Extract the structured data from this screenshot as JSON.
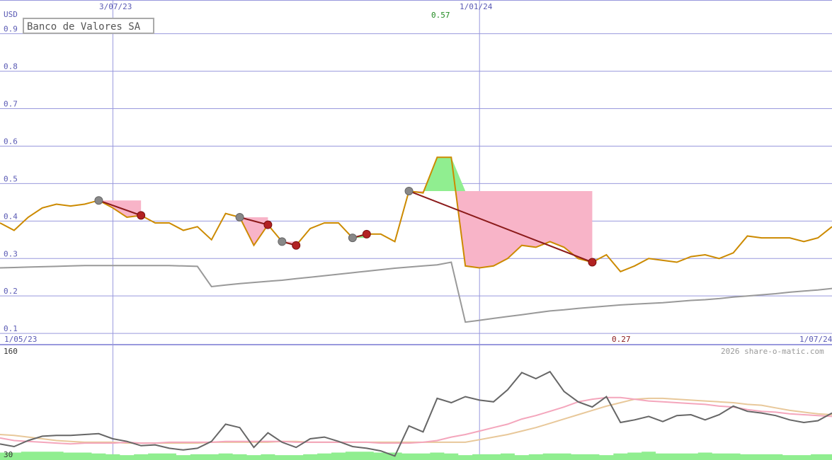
{
  "chart_data": [
    {
      "type": "line",
      "title": "Banco de Valores SA",
      "ylabel": "USD",
      "ylim": [
        0.07,
        0.99
      ],
      "y_ticks": [
        "0.9",
        "0.8",
        "0.7",
        "0.6",
        "0.5",
        "0.4",
        "0.3",
        "0.2",
        "0.1"
      ],
      "x_top_labels": [
        "3/07/23",
        "1/01/24"
      ],
      "x_bottom_labels": [
        "1/05/23",
        "1/07/24"
      ],
      "annotations": {
        "high": "0.57",
        "low": "0.27"
      },
      "colors": {
        "price": "#cc8a00",
        "moving_average": "#999999",
        "trend": "#8b1a1a",
        "grid": "#9999dd",
        "loss_fill": "#f8b4c8",
        "gain_fill": "#90ee90"
      },
      "x": [
        0,
        1,
        2,
        3,
        4,
        5,
        6,
        7,
        8,
        9,
        10,
        11,
        12,
        13,
        14,
        15,
        16,
        17,
        18,
        19,
        20,
        21,
        22,
        23,
        24,
        25,
        26,
        27,
        28,
        29,
        30,
        31,
        32,
        33,
        34,
        35,
        36,
        37,
        38,
        39,
        40,
        41,
        42,
        43,
        44,
        45,
        46,
        47,
        48,
        49,
        50,
        51,
        52,
        53,
        54,
        55,
        56,
        57,
        58,
        59
      ],
      "series": [
        {
          "role": "price",
          "values": [
            0.395,
            0.375,
            0.41,
            0.435,
            0.445,
            0.44,
            0.445,
            0.455,
            0.435,
            0.41,
            0.415,
            0.395,
            0.395,
            0.375,
            0.385,
            0.35,
            0.42,
            0.41,
            0.335,
            0.39,
            0.345,
            0.335,
            0.38,
            0.395,
            0.395,
            0.355,
            0.365,
            0.365,
            0.345,
            0.48,
            0.475,
            0.57,
            0.57,
            0.28,
            0.275,
            0.28,
            0.3,
            0.335,
            0.33,
            0.345,
            0.33,
            0.3,
            0.29,
            0.31,
            0.265,
            0.28,
            0.3,
            0.295,
            0.29,
            0.305,
            0.31,
            0.3,
            0.315,
            0.36,
            0.355,
            0.355,
            0.355,
            0.345,
            0.355,
            0.385
          ]
        },
        {
          "role": "moving_average",
          "values": [
            0.275,
            0.276,
            0.277,
            0.278,
            0.279,
            0.28,
            0.281,
            0.281,
            0.281,
            0.281,
            0.281,
            0.281,
            0.281,
            0.28,
            0.279,
            0.225,
            0.229,
            0.233,
            0.236,
            0.239,
            0.242,
            0.246,
            0.25,
            0.254,
            0.258,
            0.262,
            0.266,
            0.27,
            0.274,
            0.277,
            0.28,
            0.283,
            0.29,
            0.13,
            0.135,
            0.14,
            0.145,
            0.15,
            0.155,
            0.16,
            0.163,
            0.167,
            0.17,
            0.173,
            0.176,
            0.178,
            0.18,
            0.182,
            0.185,
            0.188,
            0.19,
            0.193,
            0.197,
            0.2,
            0.203,
            0.206,
            0.21,
            0.213,
            0.216,
            0.22
          ]
        }
      ],
      "trend_segments": [
        [
          7,
          10
        ],
        [
          17,
          19
        ],
        [
          20,
          21
        ],
        [
          25,
          26
        ],
        [
          29,
          42
        ]
      ]
    },
    {
      "type": "line",
      "ylim": [
        30,
        160
      ],
      "y_ticks": [
        "160",
        "30"
      ],
      "watermark": "2026 share-o-matic.com",
      "x": [
        0,
        1,
        2,
        3,
        4,
        5,
        6,
        7,
        8,
        9,
        10,
        11,
        12,
        13,
        14,
        15,
        16,
        17,
        18,
        19,
        20,
        21,
        22,
        23,
        24,
        25,
        26,
        27,
        28,
        29,
        30,
        31,
        32,
        33,
        34,
        35,
        36,
        37,
        38,
        39,
        40,
        41,
        42,
        43,
        44,
        45,
        46,
        47,
        48,
        49,
        50,
        51,
        52,
        53,
        54,
        55,
        56,
        57,
        58,
        59
      ],
      "series": [
        {
          "role": "momentum",
          "values": [
            47,
            44,
            51,
            56,
            57,
            57,
            58,
            59,
            53,
            50,
            45,
            46,
            42,
            40,
            42,
            50,
            70,
            66,
            43,
            60,
            49,
            43,
            53,
            55,
            50,
            44,
            42,
            39,
            33,
            68,
            61,
            100,
            95,
            102,
            98,
            96,
            110,
            130,
            123,
            131,
            108,
            96,
            90,
            102,
            72,
            75,
            79,
            73,
            80,
            81,
            75,
            81,
            91,
            85,
            83,
            80,
            75,
            72,
            74,
            83
          ]
        },
        {
          "role": "moving_average_1",
          "values": [
            54,
            51,
            50,
            49,
            48,
            47,
            48,
            48,
            48,
            49,
            48,
            48,
            49,
            49,
            49,
            49,
            50,
            50,
            50,
            50,
            50,
            49,
            49,
            49,
            49,
            49,
            49,
            48,
            48,
            48,
            49,
            51,
            55,
            58,
            62,
            66,
            70,
            76,
            80,
            85,
            90,
            96,
            99,
            101,
            101,
            99,
            97,
            96,
            95,
            94,
            93,
            91,
            90,
            87,
            85,
            84,
            82,
            81,
            80,
            79
          ]
        },
        {
          "role": "moving_average_2",
          "values": [
            58,
            57,
            55,
            53,
            51,
            50,
            49,
            49,
            49,
            48,
            48,
            48,
            48,
            48,
            48,
            49,
            49,
            49,
            49,
            49,
            50,
            50,
            49,
            49,
            49,
            49,
            49,
            49,
            49,
            49,
            49,
            49,
            49,
            49,
            52,
            55,
            58,
            62,
            66,
            71,
            76,
            81,
            86,
            91,
            95,
            99,
            100,
            100,
            99,
            98,
            97,
            96,
            95,
            93,
            92,
            89,
            86,
            84,
            82,
            81
          ]
        },
        {
          "role": "volume",
          "values": [
            37,
            37,
            38,
            38,
            38,
            37,
            37,
            36,
            35,
            34,
            35,
            36,
            36,
            34,
            35,
            35,
            36,
            35,
            34,
            35,
            34,
            34,
            35,
            36,
            37,
            38,
            38,
            37,
            37,
            36,
            36,
            37,
            36,
            34,
            35,
            35,
            36,
            34,
            35,
            36,
            36,
            35,
            35,
            34,
            36,
            37,
            38,
            36,
            36,
            36,
            37,
            36,
            36,
            35,
            35,
            35,
            34,
            34,
            35,
            35
          ]
        }
      ]
    }
  ]
}
